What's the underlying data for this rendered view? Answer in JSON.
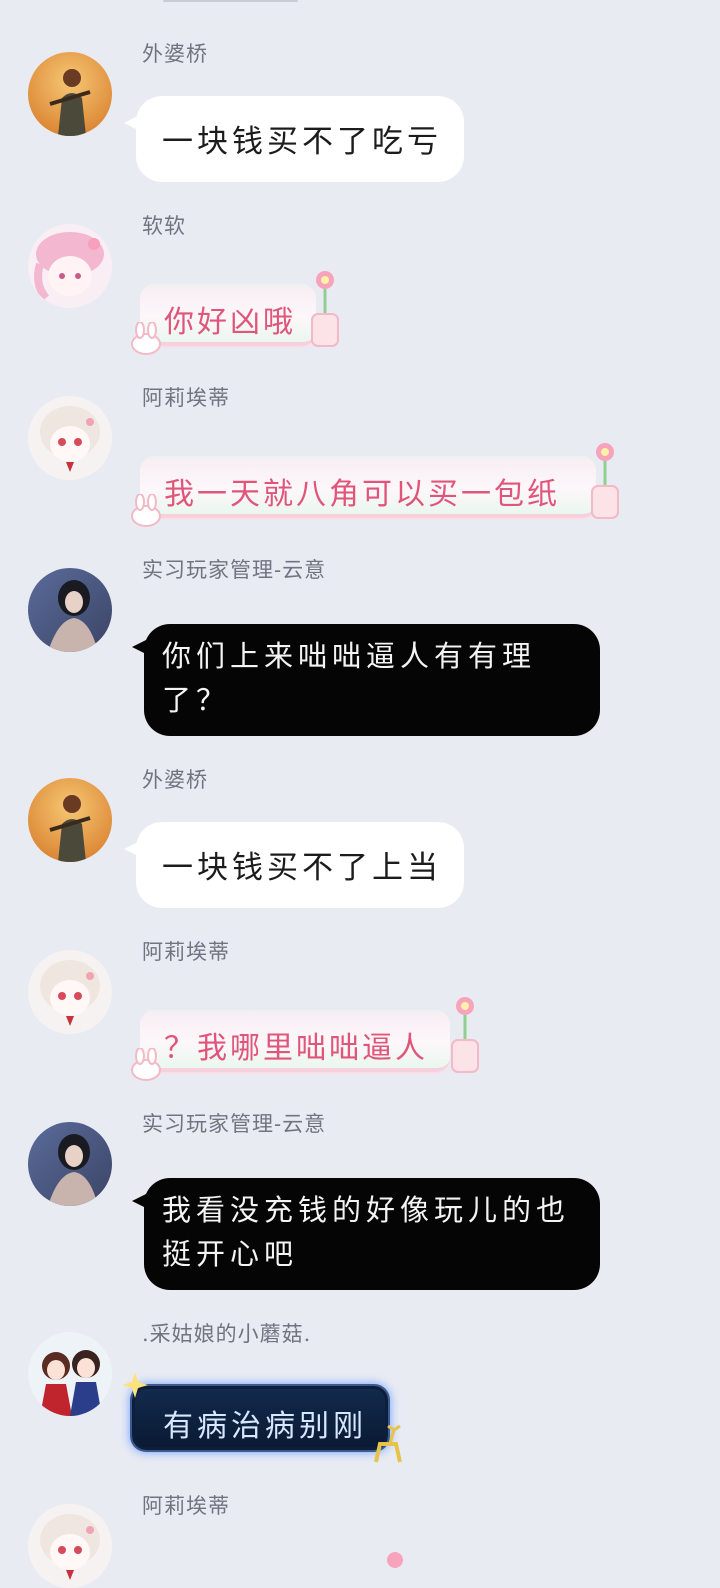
{
  "chat": {
    "messages": [
      {
        "sender": "外婆桥",
        "text": "一块钱买不了吃亏",
        "style": "white",
        "avatar": "avatar-photo-orange"
      },
      {
        "sender": "软软",
        "text": "你好凶哦",
        "style": "pink",
        "avatar": "avatar-anime-pink"
      },
      {
        "sender": "阿莉埃蒂",
        "text": "我一天就八角可以买一包纸",
        "style": "pink",
        "avatar": "avatar-anime-white"
      },
      {
        "sender": "实习玩家管理-云意",
        "text": "你们上来咄咄逼人有有理了？",
        "style": "black",
        "avatar": "avatar-photo-dark"
      },
      {
        "sender": "外婆桥",
        "text": "一块钱买不了上当",
        "style": "white",
        "avatar": "avatar-photo-orange"
      },
      {
        "sender": "阿莉埃蒂",
        "text": "？我哪里咄咄逼人",
        "style": "pink",
        "avatar": "avatar-anime-white"
      },
      {
        "sender": "实习玩家管理-云意",
        "text": "我看没充钱的好像玩儿的也挺开心吧",
        "style": "black",
        "avatar": "avatar-photo-dark"
      },
      {
        "sender": ".采姑娘的小蘑菇.",
        "text": "有病治病别刚",
        "style": "neon",
        "avatar": "avatar-anime-duo"
      },
      {
        "sender": "阿莉埃蒂",
        "text": "",
        "style": "pink",
        "avatar": "avatar-anime-white"
      }
    ]
  },
  "colors": {
    "background": "#e9ebf3",
    "sender_name": "#6f7480",
    "pink_text": "#e0567a",
    "neon_glow": "#6fa0ff"
  }
}
